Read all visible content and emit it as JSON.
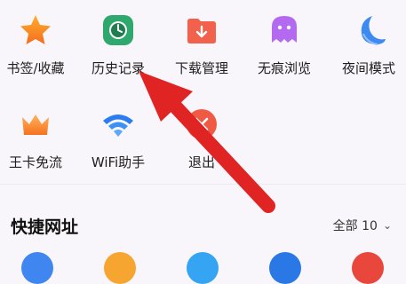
{
  "menu": {
    "items": [
      {
        "label": "书签/收藏",
        "icon": "star-icon"
      },
      {
        "label": "历史记录",
        "icon": "clock-icon"
      },
      {
        "label": "下载管理",
        "icon": "download-folder-icon"
      },
      {
        "label": "无痕浏览",
        "icon": "ghost-icon"
      },
      {
        "label": "夜间模式",
        "icon": "moon-icon"
      },
      {
        "label": "王卡免流",
        "icon": "crown-icon"
      },
      {
        "label": "WiFi助手",
        "icon": "wifi-icon"
      },
      {
        "label": "退出",
        "icon": "exit-icon"
      }
    ]
  },
  "shortcuts": {
    "title": "快捷网址",
    "more_label": "全部 10"
  },
  "colors": {
    "annotation_arrow": "#e02323",
    "accent_orange": "#f7902a",
    "accent_green": "#2fa86e",
    "accent_purple": "#b46af0",
    "accent_blue": "#2a7cf0"
  }
}
